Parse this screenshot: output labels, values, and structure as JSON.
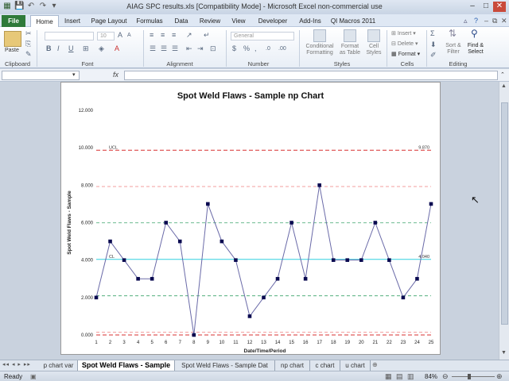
{
  "window": {
    "title": "AIAG SPC results.xls  [Compatibility Mode]  -  Microsoft Excel non-commercial use"
  },
  "ribbon_tabs": [
    "File",
    "Home",
    "Insert",
    "Page Layout",
    "Formulas",
    "Data",
    "Review",
    "View",
    "Developer",
    "Add-Ins",
    "QI Macros 2011"
  ],
  "ribbon": {
    "clipboard": {
      "label": "Clipboard",
      "paste": "Paste"
    },
    "font": {
      "label": "Font",
      "size": "10",
      "bold": "B",
      "italic": "I",
      "underline": "U"
    },
    "alignment": {
      "label": "Alignment"
    },
    "number": {
      "label": "Number",
      "format": "General",
      "currency": "$",
      "percent": "%"
    },
    "styles": {
      "label": "Styles",
      "conditional": "Conditional\nFormatting",
      "conditional_l1": "Conditional",
      "conditional_l2": "Formatting",
      "table_l1": "Format",
      "table_l2": "as Table",
      "cell_l1": "Cell",
      "cell_l2": "Styles"
    },
    "cells": {
      "label": "Cells",
      "insert": "Insert",
      "delete": "Delete",
      "format": "Format"
    },
    "editing": {
      "label": "Editing",
      "sort_l1": "Sort &",
      "sort_l2": "Filter",
      "find_l1": "Find &",
      "find_l2": "Select"
    }
  },
  "formula_bar": {
    "fx": "fx",
    "name_box": "",
    "value": ""
  },
  "chart_data": {
    "type": "line",
    "title": "Spot Weld Flaws - Sample np Chart",
    "xlabel": "Date/Time/Period",
    "ylabel": "Spot Weld Flaws - Sample",
    "ylim": [
      0,
      12
    ],
    "yticks": [
      "0.000",
      "2.000",
      "4.000",
      "6.000",
      "8.000",
      "10.000",
      "12.000"
    ],
    "x": [
      1,
      2,
      3,
      4,
      5,
      6,
      7,
      8,
      9,
      10,
      11,
      12,
      13,
      14,
      15,
      16,
      17,
      18,
      19,
      20,
      21,
      22,
      23,
      24,
      25
    ],
    "values": [
      2,
      5,
      4,
      3,
      3,
      6,
      5,
      0,
      7,
      5,
      4,
      1,
      2,
      3,
      6,
      3,
      8,
      4,
      4,
      4,
      6,
      4,
      2,
      3,
      7
    ],
    "ucl": {
      "label": "UCL",
      "value": 9.87,
      "value_label": "9.870"
    },
    "cl": {
      "label": "CL",
      "value": 4.04,
      "value_label": "4.040"
    },
    "lcl": {
      "value": 0.0
    },
    "zone_lines": [
      {
        "value": 7.93,
        "color": "#f08080"
      },
      {
        "value": 5.99,
        "color": "#3aa36a"
      },
      {
        "value": 2.09,
        "color": "#3aa36a"
      },
      {
        "value": 0.15,
        "color": "#f08080"
      }
    ],
    "colors": {
      "series": "#6a6aa8",
      "marker": "#0a0a50",
      "ucl": "#d83030",
      "cl": "#30d0e0"
    }
  },
  "sheet_tabs": [
    "p chart var",
    "Spot Weld Flaws - Sample np",
    "Spot Weld Flaws - Sample Dat",
    "np chart",
    "c chart",
    "u chart"
  ],
  "status": {
    "ready": "Ready",
    "zoom": "84%"
  }
}
